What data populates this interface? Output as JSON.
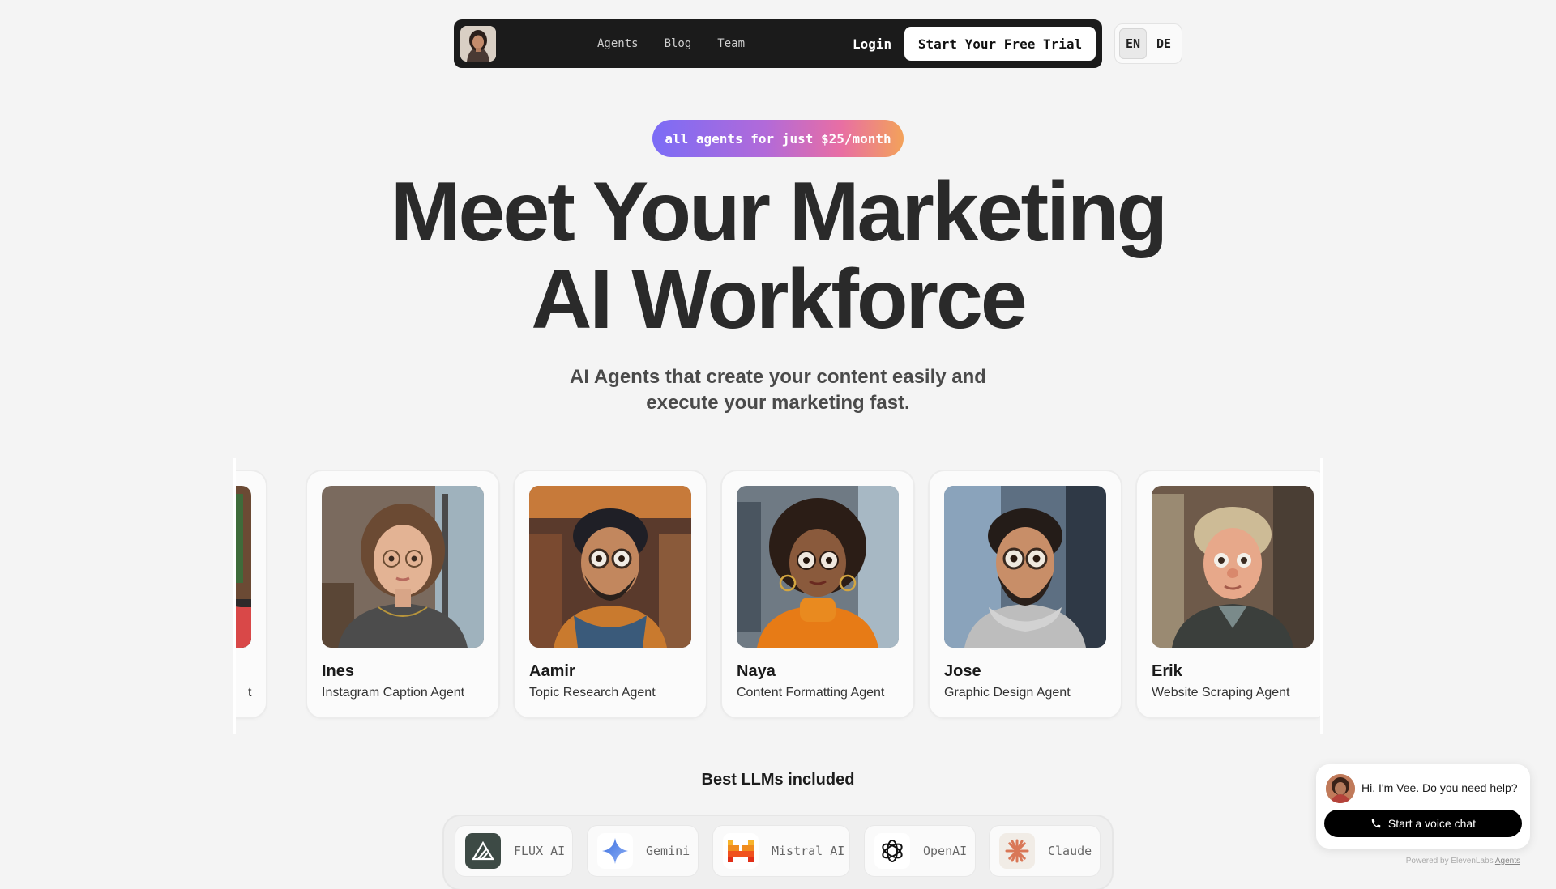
{
  "nav": {
    "links": [
      "Agents",
      "Blog",
      "Team"
    ],
    "login": "Login",
    "cta": "Start Your Free Trial"
  },
  "lang": {
    "options": [
      "EN",
      "DE"
    ],
    "active": "EN"
  },
  "hero": {
    "promo": "all agents for just $25/month",
    "title_line1": "Meet Your Marketing",
    "title_line2": "AI Workforce",
    "subtitle_line1": "AI Agents that create your content easily and",
    "subtitle_line2": "execute your marketing fast."
  },
  "agents": {
    "partial_role_tail": "t",
    "items": [
      {
        "name": "Ines",
        "role": "Instagram Caption Agent"
      },
      {
        "name": "Aamir",
        "role": "Topic Research Agent"
      },
      {
        "name": "Naya",
        "role": "Content Formatting Agent"
      },
      {
        "name": "Jose",
        "role": "Graphic Design Agent"
      },
      {
        "name": "Erik",
        "role": "Website Scraping Agent"
      }
    ]
  },
  "llms": {
    "title": "Best LLMs included",
    "items": [
      {
        "label": "FLUX AI",
        "icon": "flux-icon"
      },
      {
        "label": "Gemini",
        "icon": "gemini-icon"
      },
      {
        "label": "Mistral AI",
        "icon": "mistral-icon"
      },
      {
        "label": "OpenAI",
        "icon": "openai-icon"
      },
      {
        "label": "Claude",
        "icon": "claude-icon"
      }
    ]
  },
  "chat": {
    "greeting": "Hi, I'm Vee. Do you need help?",
    "button": "Start a voice chat",
    "powered_prefix": "Powered by ElevenLabs",
    "powered_link": "Agents"
  },
  "colors": {
    "nav_bg": "#1b1b1b",
    "promo_gradient": [
      "#7b6cf6",
      "#b26ad9",
      "#e86ea4",
      "#f3a25a"
    ],
    "page_bg": "#f4f4f4",
    "flux": "#3d4a45",
    "gemini": "#4a86f0",
    "mistral": "#f0521e",
    "claude": "#d97757"
  }
}
